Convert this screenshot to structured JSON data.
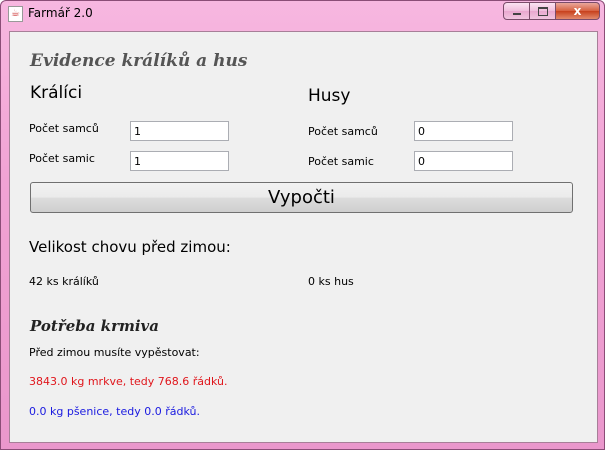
{
  "window": {
    "title": "Farmář 2.0",
    "app_icon": "java-icon",
    "close_glyph": "x"
  },
  "form": {
    "heading": "Evidence králíků a hus",
    "rabbits": {
      "title": "Králíci",
      "males_label": "Počet samců",
      "males_value": "1",
      "females_label": "Počet samic",
      "females_value": "1"
    },
    "geese": {
      "title": "Husy",
      "males_label": "Počet samců",
      "males_value": "0",
      "females_label": "Počet samic",
      "females_value": "0"
    },
    "calculate_label": "Vypočti"
  },
  "results": {
    "title": "Velikost chovu před zimou:",
    "rabbits_count": "42 ks králíků",
    "geese_count": "0 ks hus"
  },
  "feed": {
    "heading": "Potřeba krmiva",
    "intro": "Před zimou musíte vypěstovat:",
    "carrot_line": "3843.0 kg mrkve, tedy 768.6 řádků.",
    "wheat_line": "0.0 kg pšenice, tedy 0.0 řádků."
  },
  "colors": {
    "carrot_text": "#e0161c",
    "wheat_text": "#1a1ae0",
    "titlebar": "#f1a3d4"
  }
}
